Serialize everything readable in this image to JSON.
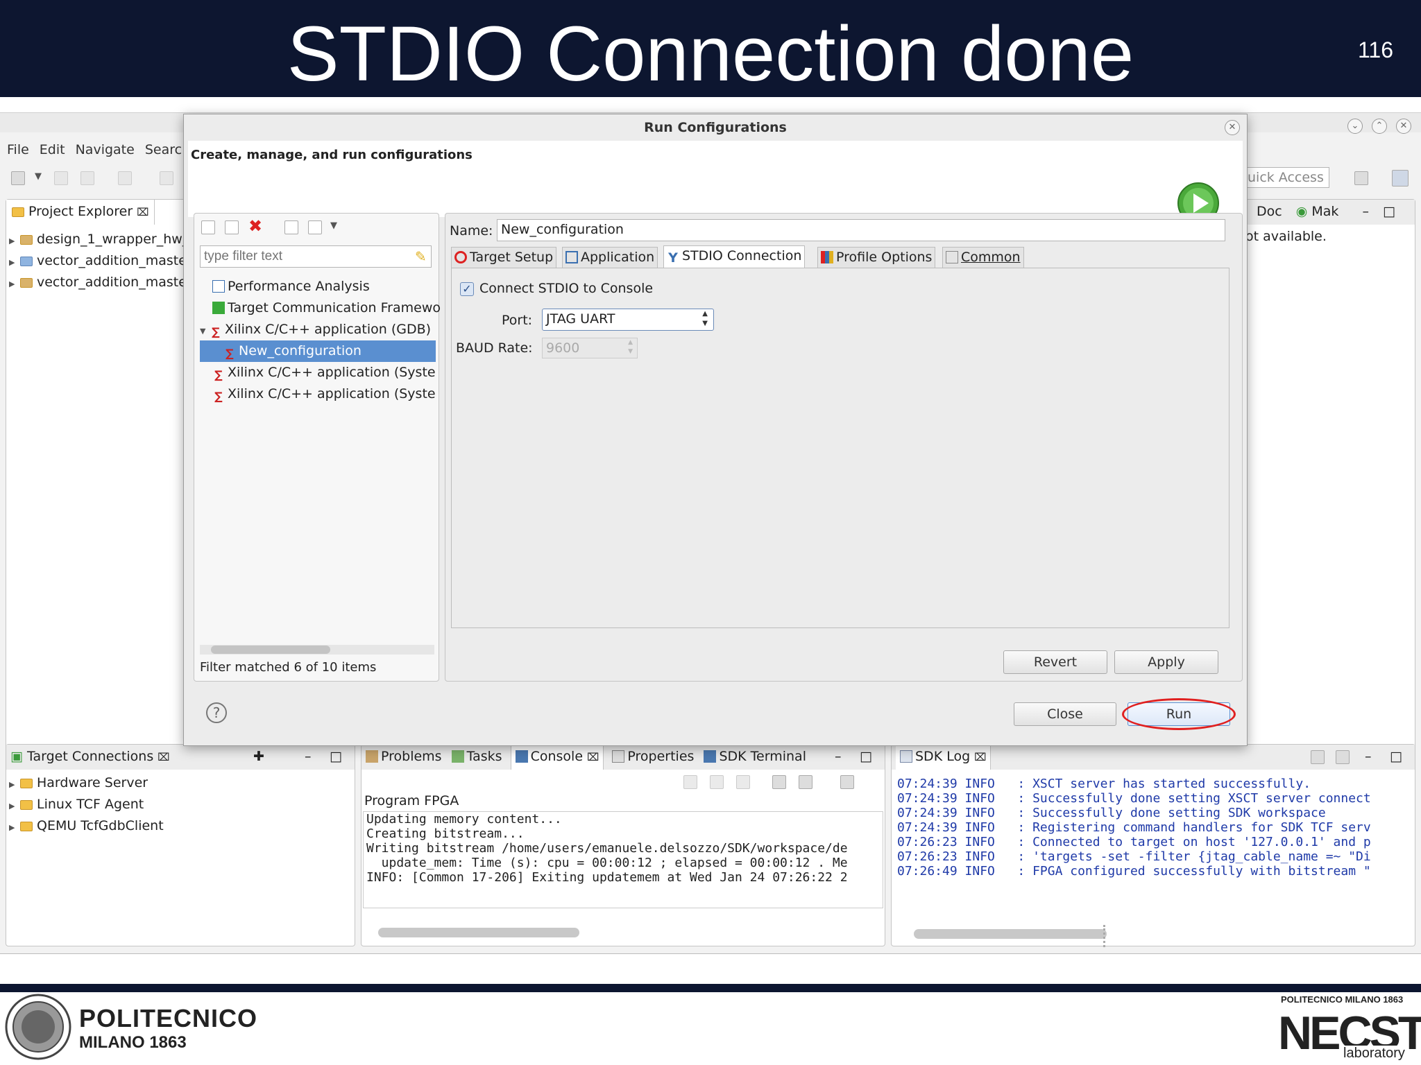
{
  "slide": {
    "title": "STDIO Connection done",
    "page_number": "116"
  },
  "eclipse": {
    "menu": [
      "File",
      "Edit",
      "Navigate",
      "Searc"
    ],
    "quick_access": "uick Access",
    "project_explorer": {
      "tab_label": "Project Explorer",
      "items": [
        "design_1_wrapper_hw_",
        "vector_addition_maste",
        "vector_addition_maste"
      ]
    },
    "right_panel": {
      "tab_doc": "Doc",
      "tab_make": "Mak",
      "message": "ot available."
    },
    "target_connections": {
      "tab_label": "Target Connections",
      "items": [
        "Hardware Server",
        "Linux TCF Agent",
        "QEMU TcfGdbClient"
      ]
    },
    "console": {
      "tabs": [
        "Problems",
        "Tasks",
        "Console",
        "Properties",
        "SDK Terminal"
      ],
      "title": "Program FPGA",
      "lines": [
        "Updating memory content...",
        "Creating bitstream...",
        "Writing bitstream /home/users/emanuele.delsozzo/SDK/workspace/de",
        "  update_mem: Time (s): cpu = 00:00:12 ; elapsed = 00:00:12 . Me",
        "INFO: [Common 17-206] Exiting updatemem at Wed Jan 24 07:26:22 2"
      ]
    },
    "sdk_log": {
      "tab_label": "SDK Log",
      "lines": [
        "07:24:39 INFO   : XSCT server has started successfully.",
        "07:24:39 INFO   : Successfully done setting XSCT server connect",
        "07:24:39 INFO   : Successfully done setting SDK workspace",
        "07:24:39 INFO   : Registering command handlers for SDK TCF serv",
        "07:26:23 INFO   : Connected to target on host '127.0.0.1' and p",
        "07:26:23 INFO   : 'targets -set -filter {jtag_cable_name =~ \"Di",
        "07:26:49 INFO   : FPGA configured successfully with bitstream \""
      ]
    }
  },
  "dialog": {
    "title": "Run Configurations",
    "header": "Create, manage, and run configurations",
    "filter_placeholder": "type filter text",
    "config_tree": [
      "Performance Analysis",
      "Target Communication Framewo",
      "Xilinx C/C++ application (GDB)",
      "New_configuration",
      "Xilinx C/C++ application (Syste",
      "Xilinx C/C++ application (Syste"
    ],
    "filter_status": "Filter matched 6 of 10 items",
    "name_label": "Name:",
    "name_value": "New_configuration",
    "tabs": [
      "Target Setup",
      "Application",
      "STDIO Connection",
      "Profile Options",
      "Common"
    ],
    "connect_label": "Connect STDIO to Console",
    "connect_checked": true,
    "port_label": "Port:",
    "port_value": "JTAG UART",
    "baud_label": "BAUD Rate:",
    "baud_value": "9600",
    "revert_label": "Revert",
    "apply_label": "Apply",
    "help_label": "?",
    "close_label": "Close",
    "run_label": "Run",
    "highlight_color": "#e02020",
    "selection_color": "#5a8fd0"
  },
  "logos": {
    "polimi_line1": "POLITECNICO",
    "polimi_line2": "MILANO 1863",
    "necst_top": "POLITECNICO MILANO 1863",
    "necst_main": "NECST",
    "necst_sub": "laboratory"
  }
}
